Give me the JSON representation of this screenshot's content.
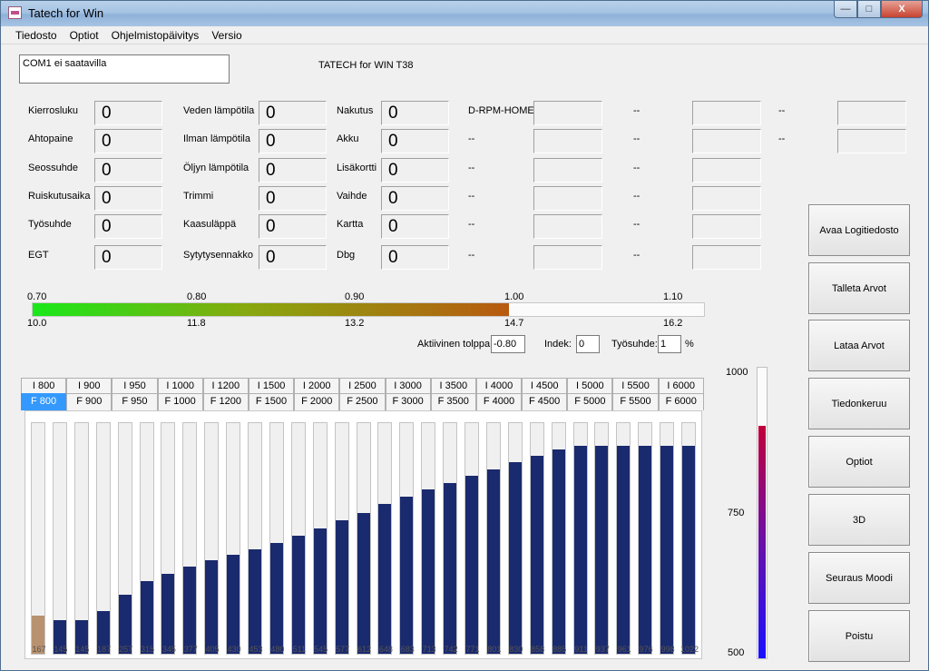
{
  "window": {
    "title": "Tatech for Win"
  },
  "window_buttons": {
    "minimize": "—",
    "maximize": "□",
    "close": "X"
  },
  "menu": [
    "Tiedosto",
    "Optiot",
    "Ohjelmistopäivitys",
    "Versio"
  ],
  "status": "COM1 ei saatavilla",
  "app_version": "TATECH for WIN T38",
  "col1": [
    {
      "label": "Kierrosluku",
      "value": "0"
    },
    {
      "label": "Ahtopaine",
      "value": "0"
    },
    {
      "label": "Seossuhde",
      "value": "0"
    },
    {
      "label": "Ruiskutusaika",
      "value": "0"
    },
    {
      "label": "Työsuhde",
      "value": "0"
    },
    {
      "label": "EGT",
      "value": "0"
    }
  ],
  "col2": [
    {
      "label": "Veden lämpötila",
      "value": "0"
    },
    {
      "label": "Ilman lämpötila",
      "value": "0"
    },
    {
      "label": "Öljyn lämpötila",
      "value": "0"
    },
    {
      "label": "Trimmi",
      "value": "0"
    },
    {
      "label": "Kaasuläppä",
      "value": "0"
    },
    {
      "label": "Sytytysennakko",
      "value": "0"
    }
  ],
  "col3": [
    {
      "label": "Nakutus",
      "value": "0"
    },
    {
      "label": "Akku",
      "value": "0"
    },
    {
      "label": "Lisäkortti",
      "value": "0"
    },
    {
      "label": "Vaihde",
      "value": "0"
    },
    {
      "label": "Kartta",
      "value": "0"
    },
    {
      "label": "Dbg",
      "value": "0"
    }
  ],
  "col4": [
    "D-RPM-HOME",
    "--",
    "--",
    "--",
    "--",
    "--"
  ],
  "col5": [
    "--",
    "--",
    "--",
    "--",
    "--",
    "--"
  ],
  "col6": [
    "--",
    "--"
  ],
  "scale": {
    "top_ticks": [
      "0.70",
      "0.80",
      "0.90",
      "1.00",
      "1.10"
    ],
    "bottom_ticks": [
      "10.0",
      "11.8",
      "13.2",
      "14.7",
      "16.2"
    ],
    "fill_fraction": 0.71
  },
  "bottom_fields": {
    "active_label": "Aktiivinen tolppa",
    "active_value": "-0.80",
    "index_label": "Indek:",
    "index_value": "0",
    "duty_label": "Työsuhde:",
    "duty_value": "1",
    "duty_unit": "%"
  },
  "tabs_i": [
    "I 800",
    "I 900",
    "I 950",
    "I 1000",
    "I 1200",
    "I 1500",
    "I 2000",
    "I 2500",
    "I 3000",
    "I 3500",
    "I 4000",
    "I 4500",
    "I 5000",
    "I 5500",
    "I 6000"
  ],
  "tabs_f": [
    "F 800",
    "F 900",
    "F 950",
    "F 1000",
    "F 1200",
    "F 1500",
    "F 2000",
    "F 2500",
    "F 3000",
    "F 3500",
    "F 4000",
    "F 4500",
    "F 5000",
    "F 5500",
    "F 6000"
  ],
  "bars": {
    "min": 0,
    "max": 1000,
    "values": [
      167,
      145,
      145,
      187,
      257,
      315,
      345,
      377,
      405,
      430,
      453,
      480,
      511,
      545,
      577,
      612,
      648,
      683,
      713,
      742,
      771,
      801,
      830,
      858,
      885,
      911,
      937,
      961,
      976,
      998,
      1022
    ]
  },
  "vscale": {
    "labels": [
      "1000",
      "750",
      "500"
    ],
    "fill_fraction": 0.8
  },
  "buttons": [
    "Avaa Logitiedosto",
    "Talleta Arvot",
    "Lataa Arvot",
    "Tiedonkeruu",
    "Optiot",
    "3D",
    "Seuraus Moodi",
    "Poistu"
  ],
  "colors": {
    "active_tab": "#3399ff",
    "bar": "#1a2a6e",
    "first_bar": "#b8926e"
  }
}
